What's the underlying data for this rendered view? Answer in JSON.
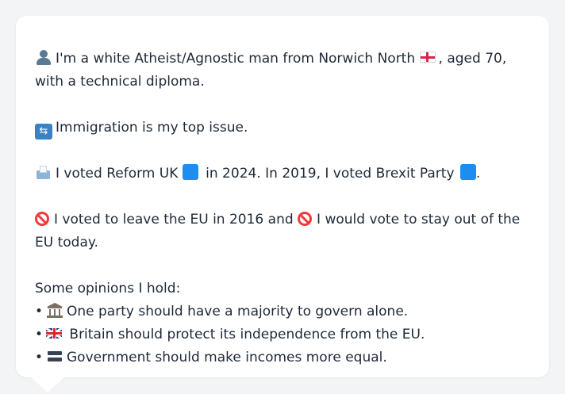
{
  "profile": {
    "intro_text": "I'm a white Atheist/Agnostic man from Norwich North",
    "intro_tail": ", aged 70, with a technical diploma.",
    "top_issue_text": "Immigration is my top issue.",
    "vote_part1": "I voted Reform UK",
    "vote_part2": "in 2024. In 2019, I voted Brexit Party",
    "vote_part3": ".",
    "eu_part1": "I voted to leave the EU in 2016 and",
    "eu_part2": "I would vote to stay out of the EU today.",
    "opinions_heading": "Some opinions I hold:",
    "opinions": [
      {
        "bullet": "•",
        "icon": "classical-building-icon",
        "text": "One party should have a majority to govern alone."
      },
      {
        "bullet": "•",
        "icon": "uk-flag-icon",
        "text": "Britain should protect its independence from the EU."
      },
      {
        "bullet": "•",
        "icon": "equals-icon",
        "text": "Government should make incomes more equal."
      }
    ]
  },
  "icons": {
    "person": "person-silhouette-icon",
    "england_flag": "england-flag-icon",
    "passport_control": "passport-control-icon",
    "ballot_box": "ballot-box-icon",
    "party_color": "blue-square-icon",
    "prohibited": "prohibited-icon"
  },
  "colors": {
    "background": "#f3f4f6",
    "card": "#ffffff",
    "text": "#1f2937",
    "reform_blue": "#1d8ef0",
    "prohibited_red": "#ef3b3b"
  }
}
